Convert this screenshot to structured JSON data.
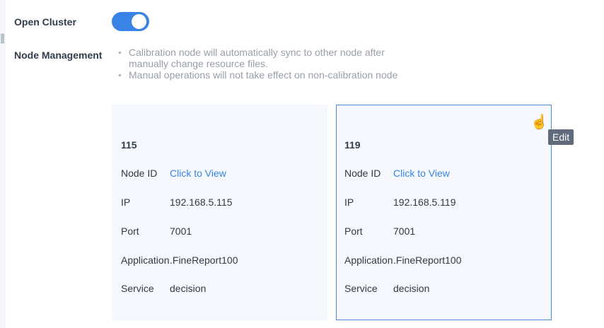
{
  "open_cluster": {
    "label": "Open Cluster",
    "enabled": true
  },
  "node_management": {
    "label": "Node Management",
    "tips": [
      "Calibration node will automatically sync to other node after manually change resource files.",
      "Manual operations will not take effect on non-calibration node"
    ]
  },
  "nodes": [
    {
      "title": "115",
      "node_id_label": "Node ID",
      "node_id_value": "Click to View",
      "ip_label": "IP",
      "ip": "192.168.5.115",
      "port_label": "Port",
      "port": "7001",
      "app_label": "Application",
      "app": ".FineReport100",
      "service_label": "Service",
      "service": "decision"
    },
    {
      "title": "119",
      "node_id_label": "Node ID",
      "node_id_value": "Click to View",
      "ip_label": "IP",
      "ip": "192.168.5.119",
      "port_label": "Port",
      "port": "7001",
      "app_label": "Application",
      "app": ".FineReport100",
      "service_label": "Service",
      "service": "decision"
    }
  ],
  "tooltip": "Edit",
  "accent": "#3a83e6"
}
